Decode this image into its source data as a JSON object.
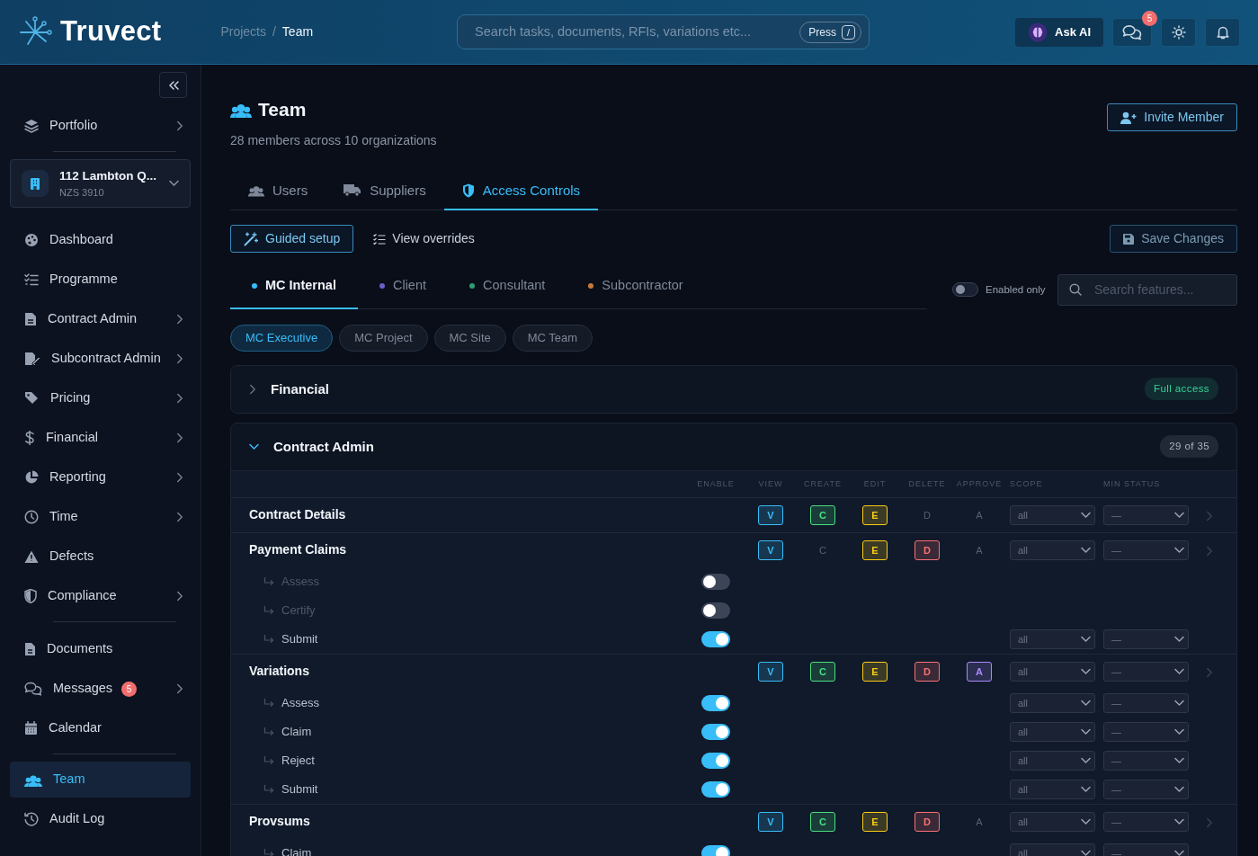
{
  "header": {
    "logo": "Truvect",
    "breadcrumb": [
      {
        "label": "Projects",
        "current": false
      },
      {
        "label": "Team",
        "current": true
      }
    ],
    "breadcrumb_separator": "/",
    "search": {
      "placeholder": "Search tasks, documents, RFIs, variations etc...",
      "shortcut_label": "Press",
      "shortcut_key": "/"
    },
    "ask_ai": "Ask AI",
    "messages_badge": "5"
  },
  "sidebar": {
    "items": [
      {
        "kind": "item",
        "label": "Portfolio",
        "submenu": true,
        "selected": false
      },
      {
        "kind": "divider"
      },
      {
        "kind": "project",
        "name": "112 Lambton Q...",
        "code": "NZS 3910"
      },
      {
        "kind": "item",
        "label": "Dashboard",
        "submenu": false,
        "selected": false
      },
      {
        "kind": "item",
        "label": "Programme",
        "submenu": false,
        "selected": false
      },
      {
        "kind": "item",
        "label": "Contract Admin",
        "submenu": true,
        "selected": false
      },
      {
        "kind": "item",
        "label": "Subcontract Admin",
        "submenu": true,
        "selected": false
      },
      {
        "kind": "item",
        "label": "Pricing",
        "submenu": true,
        "selected": false
      },
      {
        "kind": "item",
        "label": "Financial",
        "submenu": true,
        "selected": false
      },
      {
        "kind": "item",
        "label": "Reporting",
        "submenu": true,
        "selected": false
      },
      {
        "kind": "item",
        "label": "Time",
        "submenu": true,
        "selected": false
      },
      {
        "kind": "item",
        "label": "Defects",
        "submenu": false,
        "selected": false
      },
      {
        "kind": "item",
        "label": "Compliance",
        "submenu": true,
        "selected": false
      },
      {
        "kind": "divider"
      },
      {
        "kind": "item",
        "label": "Documents",
        "submenu": false,
        "selected": false
      },
      {
        "kind": "item",
        "label": "Messages",
        "submenu": true,
        "selected": false,
        "badge": "5"
      },
      {
        "kind": "item",
        "label": "Calendar",
        "submenu": false,
        "selected": false
      },
      {
        "kind": "divider"
      },
      {
        "kind": "item",
        "label": "Team",
        "submenu": false,
        "selected": true
      },
      {
        "kind": "item",
        "label": "Audit Log",
        "submenu": false,
        "selected": false
      }
    ]
  },
  "page": {
    "title": "Team",
    "subtitle": "28 members across 10 organizations",
    "invite_button": "Invite Member",
    "tabs": [
      {
        "label": "Users",
        "selected": false
      },
      {
        "label": "Suppliers",
        "selected": false
      },
      {
        "label": "Access Controls",
        "selected": true
      }
    ],
    "guided_setup": "Guided setup",
    "view_overrides": "View overrides",
    "save_button": "Save Changes",
    "role_tabs": [
      {
        "label": "MC Internal",
        "color": "#38bdf8",
        "selected": true
      },
      {
        "label": "Client",
        "color": "#6c5fc7",
        "selected": false
      },
      {
        "label": "Consultant",
        "color": "#2f9e70",
        "selected": false
      },
      {
        "label": "Subcontractor",
        "color": "#c67a3c",
        "selected": false
      }
    ],
    "enabled_only": {
      "label": "Enabled only",
      "on": false
    },
    "feature_search": {
      "placeholder": "Search features..."
    },
    "roles": [
      {
        "label": "MC Executive",
        "selected": true
      },
      {
        "label": "MC Project",
        "selected": false
      },
      {
        "label": "MC Site",
        "selected": false
      },
      {
        "label": "MC Team",
        "selected": false
      }
    ],
    "sections": [
      {
        "title": "Financial",
        "expanded": false,
        "badge": "Full access",
        "color": "#34d399"
      },
      {
        "title": "Contract Admin",
        "expanded": true,
        "badge": "29 of 35",
        "color": "#a9b2bf",
        "table": {
          "enable_header": "ENABLE",
          "scope_header": "SCOPE",
          "min_status_header": "MIN STATUS",
          "perm_columns": [
            {
              "label": "VIEW",
              "color": "#38bdf8"
            },
            {
              "label": "CREATE",
              "color": "#4ade80"
            },
            {
              "label": "EDIT",
              "color": "#facc15"
            },
            {
              "label": "DELETE",
              "color": "#f87171"
            },
            {
              "label": "APPROVE",
              "color": "#a78bfa"
            }
          ],
          "rows": [
            {
              "name": "Contract Details",
              "perms": [
                {
                  "letter": "V",
                  "on": true
                },
                {
                  "letter": "C",
                  "on": true
                },
                {
                  "letter": "E",
                  "on": true
                },
                {
                  "letter": "D",
                  "on": false
                },
                {
                  "letter": "A",
                  "on": false
                }
              ],
              "scope": "all",
              "min_status": "—",
              "children": []
            },
            {
              "name": "Payment Claims",
              "perms": [
                {
                  "letter": "V",
                  "on": true
                },
                {
                  "letter": "C",
                  "on": false
                },
                {
                  "letter": "E",
                  "on": true
                },
                {
                  "letter": "D",
                  "on": true
                },
                {
                  "letter": "A",
                  "on": false
                }
              ],
              "scope": "all",
              "min_status": "—",
              "children": [
                {
                  "name": "Assess",
                  "enabled": false
                },
                {
                  "name": "Certify",
                  "enabled": false
                },
                {
                  "name": "Submit",
                  "enabled": true,
                  "scope": "all",
                  "min_status": "—"
                }
              ]
            },
            {
              "name": "Variations",
              "perms": [
                {
                  "letter": "V",
                  "on": true
                },
                {
                  "letter": "C",
                  "on": true
                },
                {
                  "letter": "E",
                  "on": true
                },
                {
                  "letter": "D",
                  "on": true
                },
                {
                  "letter": "A",
                  "on": true
                }
              ],
              "scope": "all",
              "min_status": "—",
              "children": [
                {
                  "name": "Assess",
                  "enabled": true,
                  "scope": "all",
                  "min_status": "—"
                },
                {
                  "name": "Claim",
                  "enabled": true,
                  "scope": "all",
                  "min_status": "—"
                },
                {
                  "name": "Reject",
                  "enabled": true,
                  "scope": "all",
                  "min_status": "—"
                },
                {
                  "name": "Submit",
                  "enabled": true,
                  "scope": "all",
                  "min_status": "—"
                }
              ]
            },
            {
              "name": "Provsums",
              "perms": [
                {
                  "letter": "V",
                  "on": true
                },
                {
                  "letter": "C",
                  "on": true
                },
                {
                  "letter": "E",
                  "on": true
                },
                {
                  "letter": "D",
                  "on": true
                },
                {
                  "letter": "A",
                  "on": false
                }
              ],
              "scope": "all",
              "min_status": "—",
              "children": [
                {
                  "name": "Claim",
                  "enabled": true,
                  "scope": "all",
                  "min_status": "—"
                }
              ]
            }
          ]
        }
      }
    ]
  }
}
